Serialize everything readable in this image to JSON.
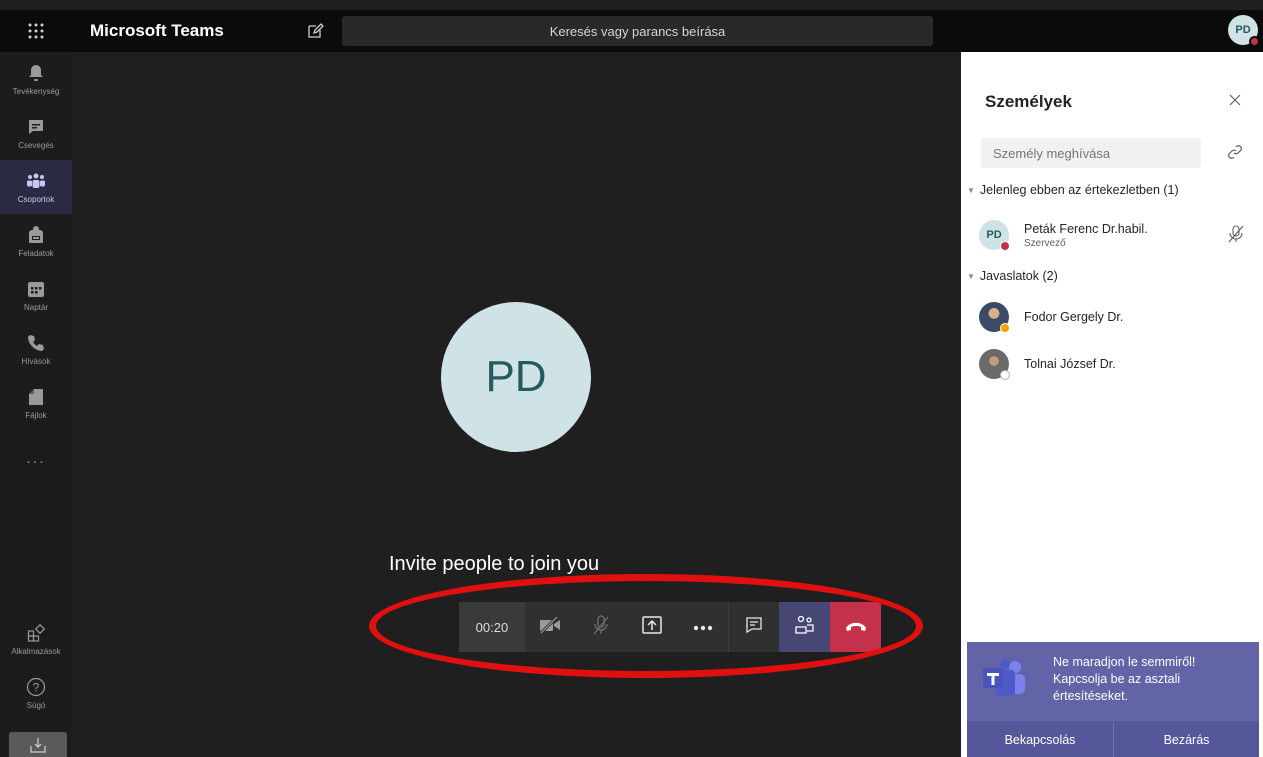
{
  "topbar": {
    "app_title": "Microsoft Teams",
    "search_placeholder": "Keresés vagy parancs beírása",
    "user_initials": "PD"
  },
  "rail": {
    "items": [
      {
        "label": "Tevékenység",
        "icon": "bell-icon"
      },
      {
        "label": "Csevegés",
        "icon": "chat-icon"
      },
      {
        "label": "Csoportok",
        "icon": "teams-icon"
      },
      {
        "label": "Feladatok",
        "icon": "backpack-icon"
      },
      {
        "label": "Naptár",
        "icon": "calendar-icon"
      },
      {
        "label": "Hívások",
        "icon": "phone-icon"
      },
      {
        "label": "Fájlok",
        "icon": "file-icon"
      }
    ],
    "active_index": 2,
    "more": "...",
    "bottom": [
      {
        "label": "Alkalmazások",
        "icon": "apps-icon"
      },
      {
        "label": "Súgó",
        "icon": "help-icon"
      }
    ]
  },
  "stage": {
    "avatar_initials": "PD",
    "invite_text": "Invite people to join you"
  },
  "callbar": {
    "timer": "00:20"
  },
  "panel": {
    "title": "Személyek",
    "invite_placeholder": "Személy meghívása",
    "in_meeting_label": "Jelenleg ebben az értekezletben (1)",
    "suggestions_label": "Javaslatok (2)",
    "in_meeting": [
      {
        "initials": "PD",
        "name": "Peták Ferenc Dr.habil.",
        "role": "Szervező",
        "status_color": "#c4314b"
      }
    ],
    "suggestions": [
      {
        "name": "Fodor Gergely Dr.",
        "status_color": "#f8a000"
      },
      {
        "name": "Tolnai József Dr.",
        "status_color": "#ffffff"
      }
    ]
  },
  "toast": {
    "message": "Ne maradjon le semmiről! Kapcsolja be az asztali értesítéseket.",
    "enable_label": "Bekapcsolás",
    "close_label": "Bezárás"
  },
  "colors": {
    "accent": "#6264a7",
    "hangup": "#c4314b",
    "annotation": "#e01010"
  }
}
